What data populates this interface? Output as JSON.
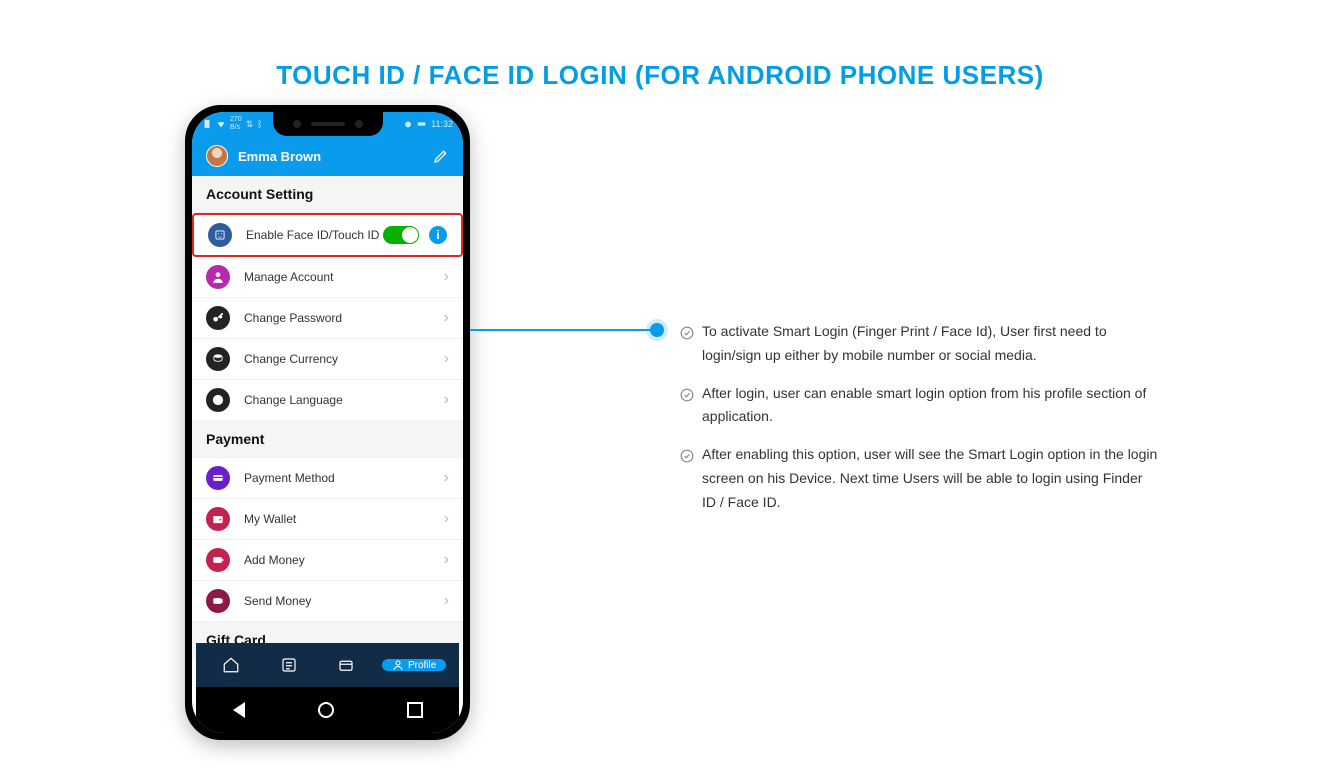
{
  "page_title": "TOUCH ID / FACE ID LOGIN (FOR ANDROID PHONE USERS)",
  "status_bar": {
    "time": "11:32",
    "data": "270\nB/s"
  },
  "header": {
    "user_name": "Emma Brown"
  },
  "sections": {
    "account": {
      "title": "Account Setting",
      "items": {
        "faceid": {
          "label": "Enable Face ID/Touch ID"
        },
        "manage": {
          "label": "Manage Account"
        },
        "password": {
          "label": "Change Password"
        },
        "currency": {
          "label": "Change Currency"
        },
        "language": {
          "label": "Change Language"
        }
      }
    },
    "payment": {
      "title": "Payment",
      "items": {
        "method": {
          "label": "Payment Method"
        },
        "wallet": {
          "label": "My Wallet"
        },
        "add": {
          "label": "Add Money"
        },
        "send": {
          "label": "Send Money"
        }
      }
    },
    "giftcard": {
      "title": "Gift Card"
    }
  },
  "bottom_nav": {
    "profile": "Profile"
  },
  "bullets": [
    "To activate Smart Login (Finger Print / Face Id), User first need to login/sign up either by mobile number or social media.",
    "After login, user can enable smart login option from his profile section of application.",
    "After enabling this option, user will see the Smart Login option in the login screen on his Device. Next time Users will be able to login using Finder ID / Face ID."
  ],
  "colors": {
    "accent": "#0a9bec",
    "faceid_icon": "#2b5d9c",
    "manage_icon": "#b82aad",
    "password_icon": "#232323",
    "currency_icon": "#232323",
    "language_icon": "#232323",
    "method_icon": "#6b1fca",
    "wallet_icon": "#c5214f",
    "add_icon": "#c5214f",
    "send_icon": "#8c1a47"
  }
}
